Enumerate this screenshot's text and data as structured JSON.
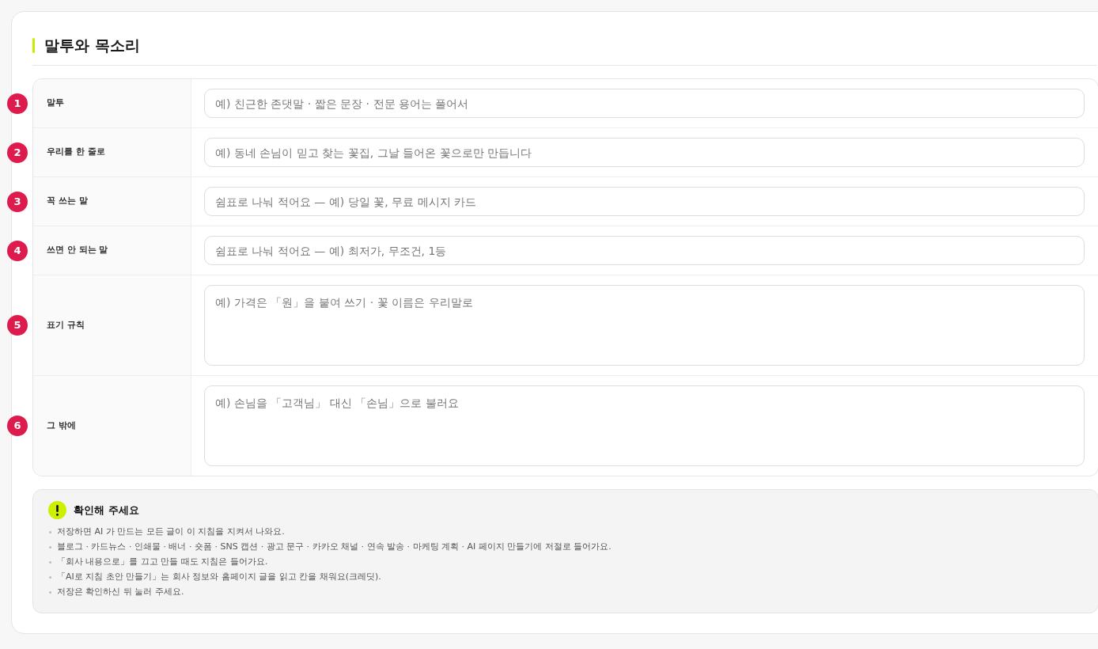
{
  "section": {
    "title": "말투와 목소리"
  },
  "fields": [
    {
      "number": "1",
      "label": "말투",
      "kind": "input",
      "placeholder": "예) 친근한 존댓말 · 짧은 문장 · 전문 용어는 풀어서"
    },
    {
      "number": "2",
      "label": "우리를 한 줄로",
      "kind": "input",
      "placeholder": "예) 동네 손님이 믿고 찾는 꽃집, 그날 들어온 꽃으로만 만듭니다"
    },
    {
      "number": "3",
      "label": "꼭 쓰는 말",
      "kind": "input",
      "placeholder": "쉼표로 나눠 적어요 — 예) 당일 꽃, 무료 메시지 카드"
    },
    {
      "number": "4",
      "label": "쓰면 안 되는 말",
      "kind": "input",
      "placeholder": "쉼표로 나눠 적어요 — 예) 최저가, 무조건, 1등"
    },
    {
      "number": "5",
      "label": "표기 규칙",
      "kind": "textarea",
      "placeholder": "예) 가격은 「원」을 붙여 쓰기 · 꽃 이름은 우리말로"
    },
    {
      "number": "6",
      "label": "그 밖에",
      "kind": "textarea",
      "placeholder": "예) 손님을 「고객님」 대신 「손님」으로 불러요"
    }
  ],
  "notice": {
    "title": "확인해 주세요",
    "items": [
      "저장하면 AI 가 만드는 모든 글이 이 지침을 지켜서 나와요.",
      "블로그 · 카드뉴스 · 인쇄물 · 배너 · 숏폼 · SNS 캡션 · 광고 문구 · 카카오 채널 · 연속 발송 · 마케팅 계획 · AI 페이지 만들기에 저절로 들어가요.",
      "「회사 내용으로」를 끄고 만들 때도 지침은 들어가요.",
      "「AI로 지침 초안 만들기」는 회사 정보와 홈페이지 글을 읽고 칸을 채워요(크레딧).",
      "저장은 확인하신 뒤 눌러 주세요."
    ]
  }
}
